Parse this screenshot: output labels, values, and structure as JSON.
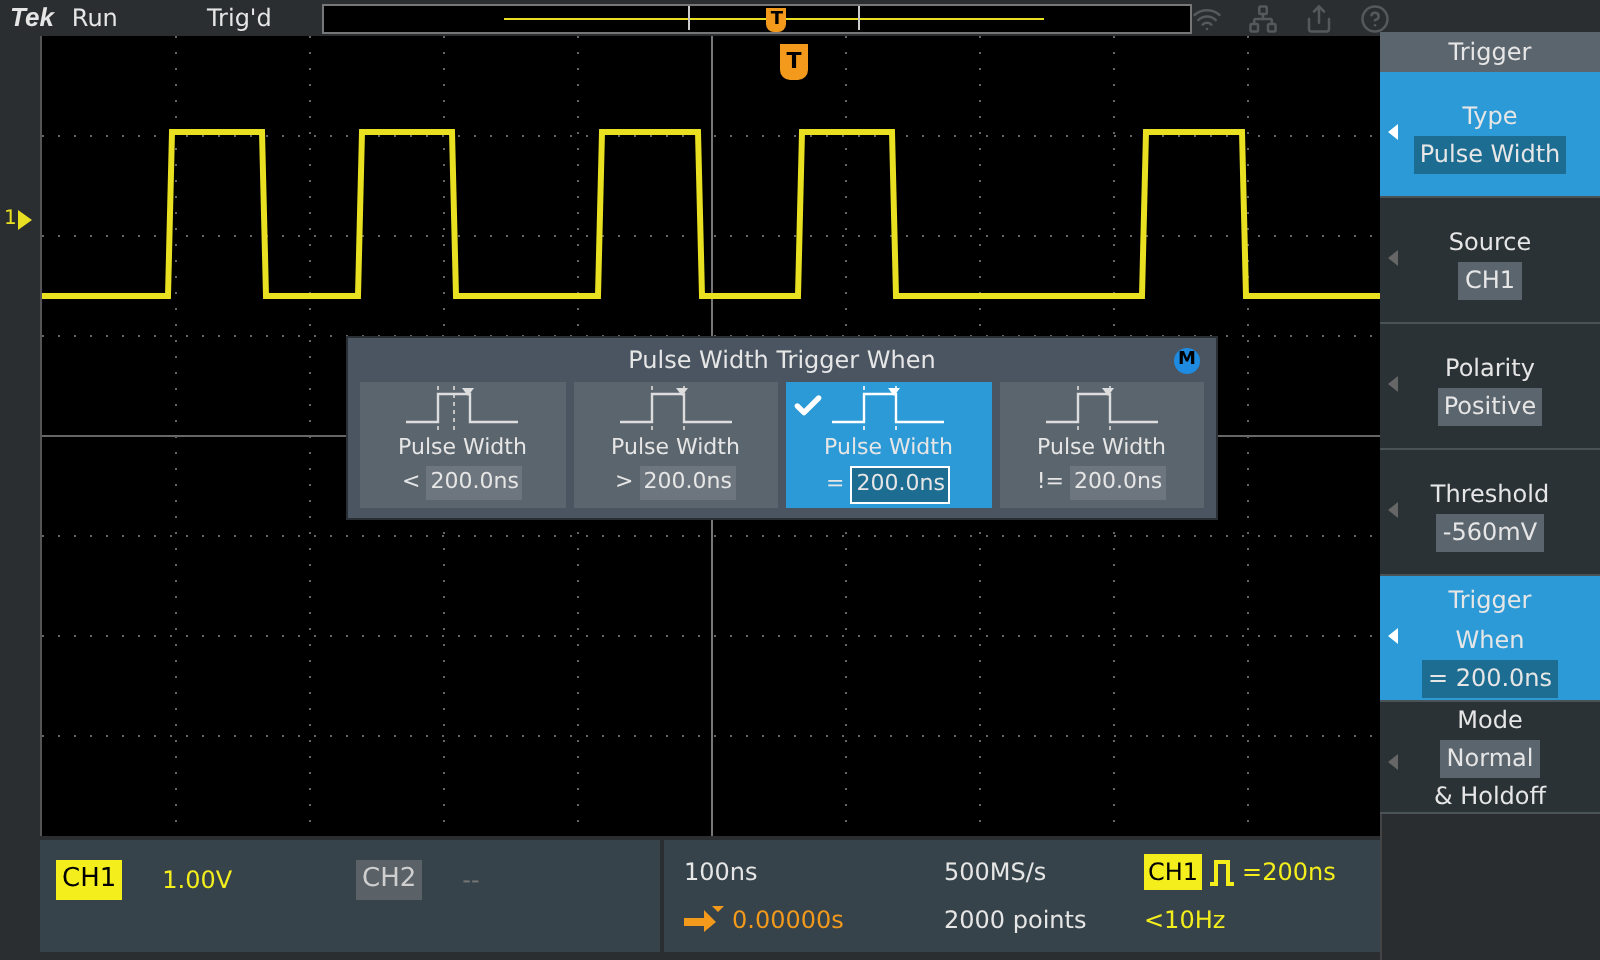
{
  "top_bar": {
    "brand": "Tek",
    "run_state": "Run",
    "trigger_state": "Trig'd"
  },
  "markers": {
    "channel": "1",
    "trigger": "T",
    "record_trigger": "T"
  },
  "dialog": {
    "title": "Pulse Width Trigger When",
    "badge": "M",
    "options": [
      {
        "label": "Pulse Width",
        "operator": "<",
        "value": "200.0ns",
        "selected": false
      },
      {
        "label": "Pulse Width",
        "operator": ">",
        "value": "200.0ns",
        "selected": false
      },
      {
        "label": "Pulse Width",
        "operator": "=",
        "value": "200.0ns",
        "selected": true
      },
      {
        "label": "Pulse Width",
        "operator": "!=",
        "value": "200.0ns",
        "selected": false
      }
    ]
  },
  "side_menu": {
    "title": "Trigger",
    "items": [
      {
        "label": "Type",
        "value": "Pulse Width",
        "selected": true
      },
      {
        "label": "Source",
        "value": "CH1",
        "selected": false
      },
      {
        "label": "Polarity",
        "value": "Positive",
        "selected": false
      },
      {
        "label": "Threshold",
        "value": "-560mV",
        "selected": false
      },
      {
        "label": "Trigger When",
        "value": "= 200.0ns",
        "selected": true
      },
      {
        "label": "Mode",
        "value": "Normal",
        "suffix": "& Holdoff",
        "selected": false
      }
    ]
  },
  "channels": [
    {
      "label": "CH1",
      "scale": "1.00V",
      "active": true
    },
    {
      "label": "CH2",
      "scale": "--",
      "active": false
    }
  ],
  "horizontal": {
    "scale": "100ns",
    "delay": "0.00000s",
    "sample_rate": "500MS/s",
    "record_length": "2000 points"
  },
  "trigger_readout": {
    "source": "CH1",
    "width": "=200ns",
    "frequency": "<10Hz"
  }
}
